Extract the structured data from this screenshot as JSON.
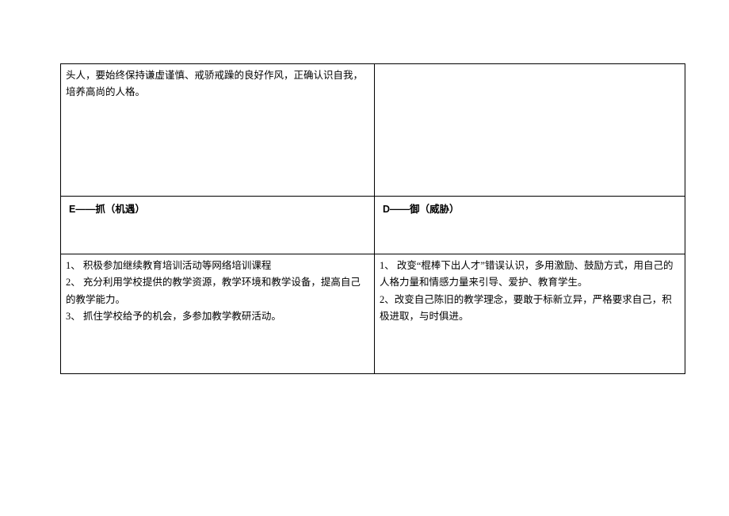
{
  "row1": {
    "left": "头人，要始终保持谦虚谨慎、戒骄戒躁的良好作风，正确认识自我，培养高尚的人格。",
    "right": ""
  },
  "row2": {
    "left_header": "E——抓（机遇）",
    "right_header": "D——御（威胁）"
  },
  "row3": {
    "left_lines": [
      "1、 积极参加继续教育培训活动等网络培训课程",
      "2、 充分利用学校提供的教学资源，教学环境和教学设备，提高自己的教学能力。",
      "3、 抓住学校给予的机会，多参加教学教研活动。"
    ],
    "right_lines": [
      "1、 改变“棍棒下出人才”错误认识，多用激励、鼓励方式，用自己的人格力量和情感力量来引导、爱护、教育学生。",
      "2、改变自己陈旧的教学理念，要敢于标新立异，严格要求自己，积极进取，与时俱进。"
    ]
  }
}
